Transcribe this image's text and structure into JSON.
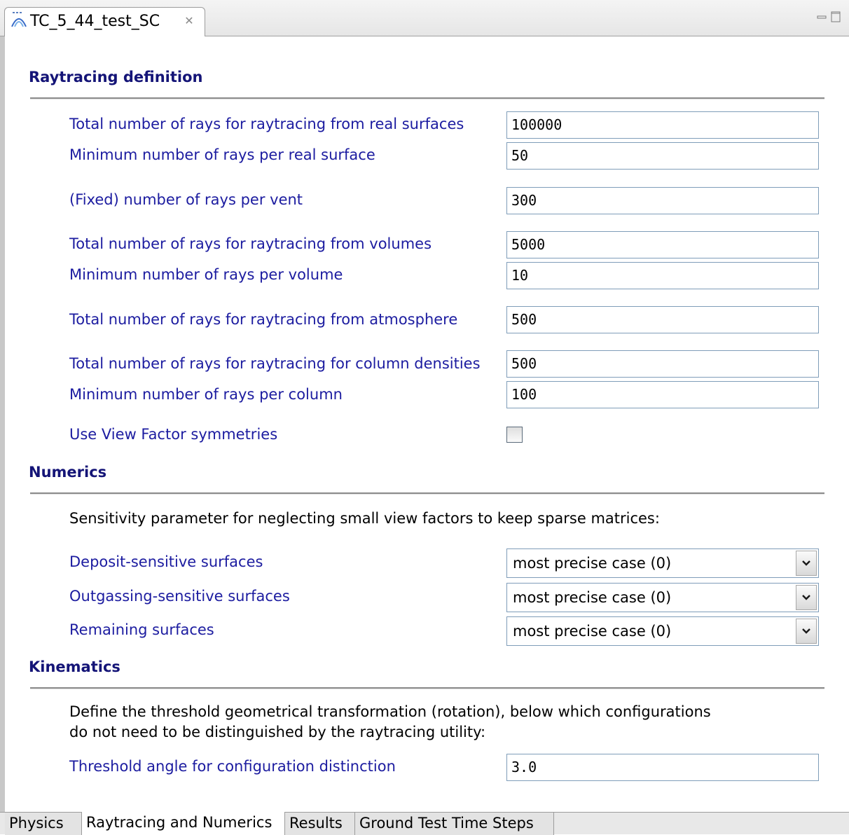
{
  "editor": {
    "tab_title": "TC_5_44_test_SC",
    "tab_icon": "model-icon",
    "close_icon": "close-icon",
    "minimize_icon": "minimize-icon",
    "maximize_icon": "maximize-icon"
  },
  "raytracing": {
    "title": "Raytracing definition",
    "fields": [
      {
        "label": "Total number of rays for raytracing from real surfaces",
        "value": "100000"
      },
      {
        "label": "Minimum number of rays per real surface",
        "value": "50"
      },
      {
        "label": "(Fixed) number of rays per vent",
        "value": "300"
      },
      {
        "label": "Total number of rays for raytracing from volumes",
        "value": "5000"
      },
      {
        "label": "Minimum number of rays per volume",
        "value": "10"
      },
      {
        "label": "Total number of rays for raytracing from atmosphere",
        "value": "500"
      },
      {
        "label": "Total number of rays for raytracing for column densities",
        "value": "500"
      },
      {
        "label": "Minimum number of rays per column",
        "value": "100"
      }
    ],
    "symmetry_label": "Use View Factor symmetries",
    "symmetry_checked": false
  },
  "numerics": {
    "title": "Numerics",
    "description": "Sensitivity parameter for neglecting small view factors to keep sparse matrices:",
    "dropdowns": [
      {
        "label": "Deposit-sensitive surfaces",
        "value": "most precise case (0)"
      },
      {
        "label": "Outgassing-sensitive surfaces",
        "value": "most precise case (0)"
      },
      {
        "label": "Remaining surfaces",
        "value": "most precise case (0)"
      }
    ]
  },
  "kinematics": {
    "title": "Kinematics",
    "description_line1": "Define the threshold geometrical transformation (rotation), below which configurations",
    "description_line2": "do not need to be distinguished by the raytracing utility:",
    "threshold_label": "Threshold angle for configuration distinction",
    "threshold_value": "3.0"
  },
  "page_tabs": [
    {
      "label": "Physics",
      "active": false
    },
    {
      "label": "Raytracing and Numerics",
      "active": true
    },
    {
      "label": "Results",
      "active": false
    },
    {
      "label": "Ground Test Time Steps",
      "active": false
    }
  ],
  "colors": {
    "section_title": "#141477",
    "field_label": "#1c1ca0",
    "input_border": "#7f9db9"
  }
}
